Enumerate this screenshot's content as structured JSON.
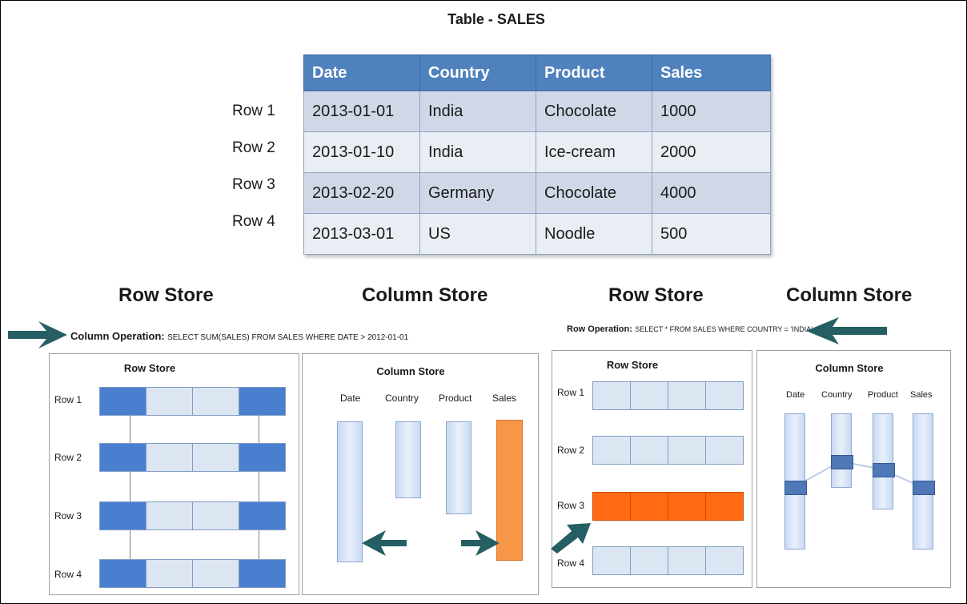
{
  "table": {
    "title": "Table - SALES",
    "headers": [
      "Date",
      "Country",
      "Product",
      "Sales"
    ],
    "rows": [
      [
        "2013-01-01",
        "India",
        "Chocolate",
        "1000"
      ],
      [
        "2013-01-10",
        "India",
        "Ice-cream",
        "2000"
      ],
      [
        "2013-02-20",
        "Germany",
        "Chocolate",
        "4000"
      ],
      [
        "2013-03-01",
        "US",
        "Noodle",
        "500"
      ]
    ],
    "row_labels": [
      "Row 1",
      "Row 2",
      "Row 3",
      "Row 4"
    ]
  },
  "sections": {
    "left_row_store": "Row Store",
    "left_column_store": "Column Store",
    "right_row_store": "Row Store",
    "right_column_store": "Column Store"
  },
  "column_operation": {
    "label": "Column Operation:",
    "query": "SELECT SUM(SALES) FROM SALES WHERE DATE > 2012-01-01"
  },
  "row_operation": {
    "label": "Row Operation:",
    "query": "SELECT * FROM SALES WHERE COUNTRY = 'INDIA'"
  },
  "panels": {
    "row_store_title": "Row Store",
    "column_store_title": "Column Store",
    "column_names": [
      "Date",
      "Country",
      "Product",
      "Sales"
    ],
    "row_names": [
      "Row 1",
      "Row 2",
      "Row 3",
      "Row 4"
    ]
  },
  "colors": {
    "header_blue": "#4f81bd",
    "dark_blue": "#4a7fcf",
    "light_cell": "#dce6f2",
    "highlight_orange": "#ff6a13",
    "column_orange": "#f79646",
    "arrow_teal": "#255f63"
  }
}
